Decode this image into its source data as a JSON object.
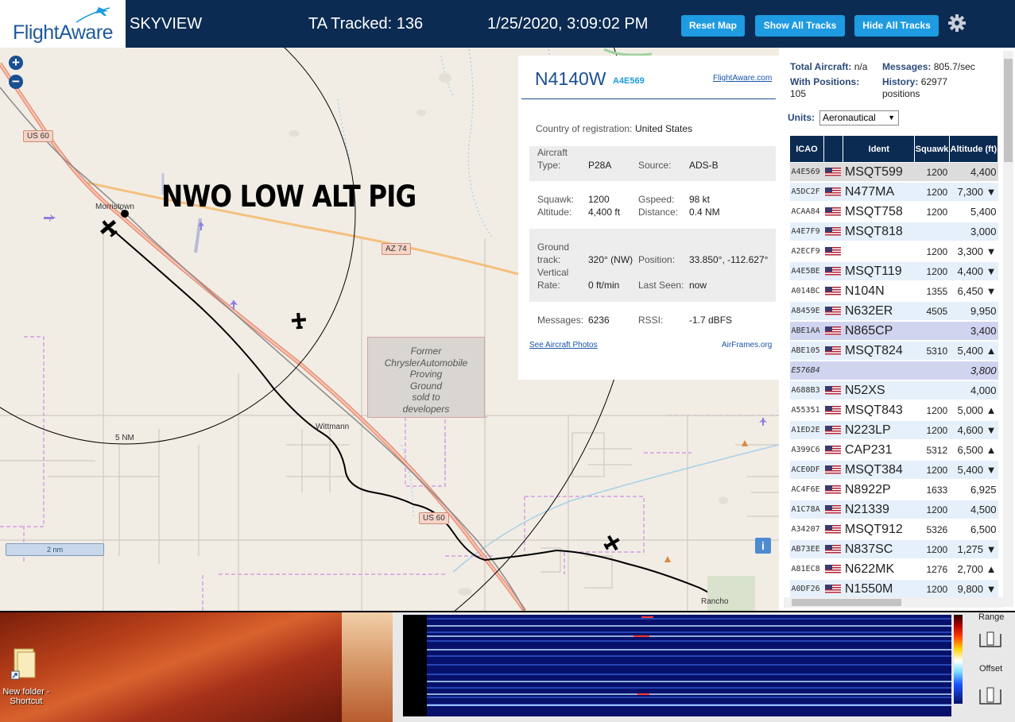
{
  "header": {
    "logo": "FlightAware",
    "title": "SKYVIEW",
    "tracked": "TA Tracked: 136",
    "datetime": "1/25/2020, 3:09:02 PM",
    "buttons": {
      "reset_map": "Reset Map",
      "show_all": "Show All Tracks",
      "hide_all": "Hide All Tracks"
    }
  },
  "map": {
    "annotation": "NWO LOW ALT PIG",
    "shields": {
      "us60_a": "US 60",
      "az74": "AZ 74",
      "us60_b": "US 60"
    },
    "places": {
      "morristown": "Morristown",
      "wittmann": "Wittmann",
      "rancho": "Rancho"
    },
    "chrysler": [
      "Former",
      "ChryslerAutomobile",
      "Proving",
      "Ground",
      "sold to",
      "developers"
    ],
    "range_label": "5 NM",
    "scale": "2 nm",
    "info": "i"
  },
  "selected": {
    "callsign": "N4140W",
    "hex": "A4E569",
    "fa_link": "FlightAware.com",
    "country_label": "Country of registration:",
    "country_value": "United States",
    "aircraft_type_label1": "Aircraft",
    "aircraft_type_label2": "Type:",
    "aircraft_type": "P28A",
    "source_label": "Source:",
    "source": "ADS-B",
    "squawk_label": "Squawk:",
    "squawk": "1200",
    "gspeed_label": "Gspeed:",
    "gspeed": "98 kt",
    "altitude_label": "Altitude:",
    "altitude": "4,400 ft",
    "distance_label": "Distance:",
    "distance": "0.4 NM",
    "track_label1": "Ground",
    "track_label2": "track:",
    "track": "320° (NW)",
    "position_label": "Position:",
    "position": "33.850°, -112.627°",
    "vrate_label1": "Vertical",
    "vrate_label2": "Rate:",
    "vrate": "0 ft/min",
    "lastseen_label": "Last Seen:",
    "lastseen": "now",
    "messages_label": "Messages:",
    "messages": "6236",
    "rssi_label": "RSSI:",
    "rssi": "-1.7 dBFS",
    "photos_link": "See Aircraft Photos",
    "airframes_link": "AirFrames.org"
  },
  "sidebar": {
    "total_label": "Total Aircraft:",
    "total_value": "n/a",
    "messages_label": "Messages:",
    "messages_value": "805.7/sec",
    "positions_label": "With Positions:",
    "positions_value": "105",
    "history_label": "History:",
    "history_value": "62977",
    "history_unit": "positions",
    "units_label": "Units:",
    "units_value": "Aeronautical",
    "columns": [
      "ICAO",
      "",
      "Ident",
      "Squawk",
      "Altitude (ft)"
    ],
    "rows": [
      {
        "icao": "A4E569",
        "ident": "MSQT599",
        "squawk": "1200",
        "alt": "4,400",
        "state": "sel"
      },
      {
        "icao": "A5DC2F",
        "ident": "N477MA",
        "squawk": "1200",
        "alt": "7,300 ▼",
        "state": "odd"
      },
      {
        "icao": "ACAA84",
        "ident": "MSQT758",
        "squawk": "1200",
        "alt": "5,400",
        "state": "even"
      },
      {
        "icao": "A4E7F9",
        "ident": "MSQT818",
        "squawk": "",
        "alt": "3,000",
        "state": "odd"
      },
      {
        "icao": "A2ECF9",
        "ident": "",
        "squawk": "1200",
        "alt": "3,300 ▼",
        "state": "even"
      },
      {
        "icao": "A4E5BE",
        "ident": "MSQT119",
        "squawk": "1200",
        "alt": "4,400 ▼",
        "state": "odd"
      },
      {
        "icao": "A014BC",
        "ident": "N104N",
        "squawk": "1355",
        "alt": "6,450 ▼",
        "state": "even"
      },
      {
        "icao": "A8459E",
        "ident": "N632ER",
        "squawk": "4505",
        "alt": "9,950",
        "state": "odd"
      },
      {
        "icao": "ABE1AA",
        "ident": "N865CP",
        "squawk": "",
        "alt": "3,400",
        "state": "nopos"
      },
      {
        "icao": "ABE105",
        "ident": "MSQT824",
        "squawk": "5310",
        "alt": "5,400 ▲",
        "state": "odd"
      },
      {
        "icao": "E576B4",
        "ident": "",
        "squawk": "",
        "alt": "3,800",
        "state": "ital"
      },
      {
        "icao": "A688B3",
        "ident": "N52XS",
        "squawk": "",
        "alt": "4,000",
        "state": "odd"
      },
      {
        "icao": "A55351",
        "ident": "MSQT843",
        "squawk": "1200",
        "alt": "5,000 ▲",
        "state": "even"
      },
      {
        "icao": "A1ED2E",
        "ident": "N223LP",
        "squawk": "1200",
        "alt": "4,600 ▼",
        "state": "odd"
      },
      {
        "icao": "A399C6",
        "ident": "CAP231",
        "squawk": "5312",
        "alt": "6,500 ▲",
        "state": "even"
      },
      {
        "icao": "ACE0DF",
        "ident": "MSQT384",
        "squawk": "1200",
        "alt": "5,400 ▼",
        "state": "odd"
      },
      {
        "icao": "AC4F6E",
        "ident": "N8922P",
        "squawk": "1633",
        "alt": "6,925",
        "state": "even"
      },
      {
        "icao": "A1C78A",
        "ident": "N21339",
        "squawk": "1200",
        "alt": "4,500",
        "state": "odd"
      },
      {
        "icao": "A34207",
        "ident": "MSQT912",
        "squawk": "5326",
        "alt": "6,500",
        "state": "even"
      },
      {
        "icao": "AB73EE",
        "ident": "N837SC",
        "squawk": "1200",
        "alt": "1,275 ▼",
        "state": "odd"
      },
      {
        "icao": "A81EC8",
        "ident": "N622MK",
        "squawk": "1276",
        "alt": "2,700 ▲",
        "state": "even"
      },
      {
        "icao": "A0DF26",
        "ident": "N1550M",
        "squawk": "1200",
        "alt": "9,800 ▼",
        "state": "odd"
      }
    ]
  },
  "desktop": {
    "folder_label": "New folder - Shortcut"
  },
  "waterfall": {
    "range_label": "Range",
    "offset_label": "Offset"
  },
  "colors": {
    "header_bg": "#0b2b52",
    "button": "#1e9be1",
    "accent": "#1f5a9c"
  }
}
